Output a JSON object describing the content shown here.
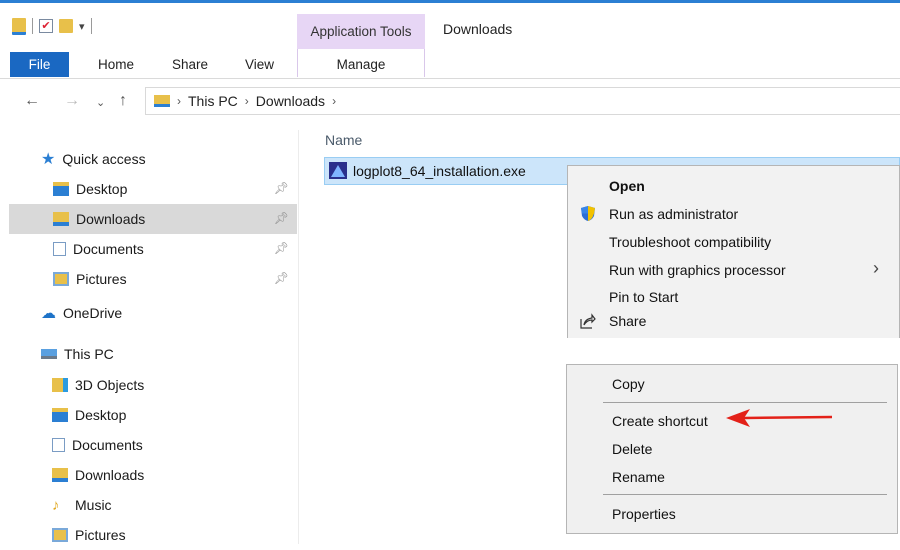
{
  "ribbon": {
    "context_tab": "Application Tools",
    "window_title": "Downloads",
    "tabs": {
      "file": "File",
      "home": "Home",
      "share": "Share",
      "view": "View",
      "manage": "Manage"
    }
  },
  "address": {
    "breadcrumbs": [
      "This PC",
      "Downloads"
    ]
  },
  "nav": {
    "quick_access": "Quick access",
    "qa_items": [
      "Desktop",
      "Downloads",
      "Documents",
      "Pictures"
    ],
    "onedrive": "OneDrive",
    "this_pc": "This PC",
    "pc_items": [
      "3D Objects",
      "Desktop",
      "Documents",
      "Downloads",
      "Music",
      "Pictures"
    ]
  },
  "files": {
    "column_name": "Name",
    "items": [
      {
        "name": "logplot8_64_installation.exe"
      }
    ]
  },
  "context_menu": {
    "open": "Open",
    "run_as_admin": "Run as administrator",
    "troubleshoot": "Troubleshoot compatibility",
    "run_gpu": "Run with graphics processor",
    "pin_start": "Pin to Start",
    "share": "Share",
    "copy": "Copy",
    "create_shortcut": "Create shortcut",
    "delete": "Delete",
    "rename": "Rename",
    "properties": "Properties"
  },
  "colors": {
    "accent": "#1a68c2",
    "context_tab": "#e7d6f5",
    "selection": "#cce5fa",
    "annotation_arrow": "#e32119"
  }
}
